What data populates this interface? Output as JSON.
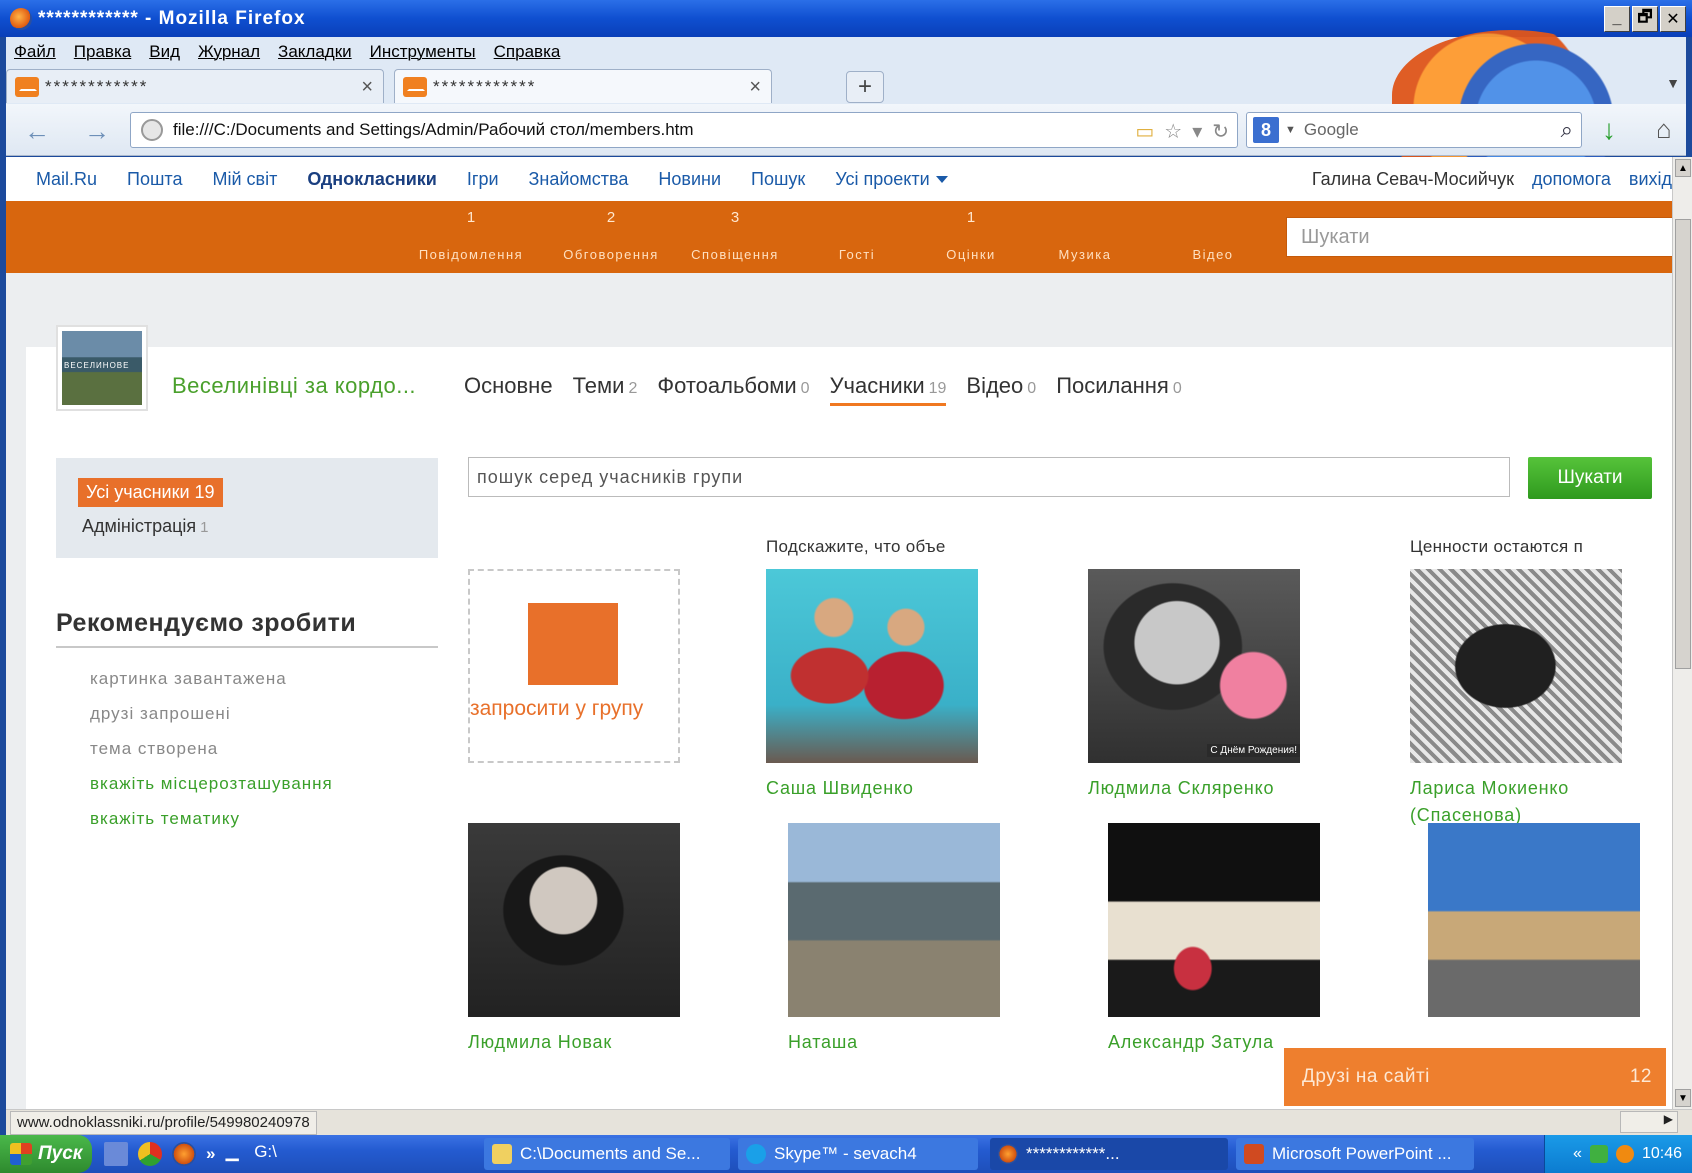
{
  "window": {
    "title": "************ - Mozilla Firefox",
    "controls": [
      "_",
      "🗗",
      "✕"
    ]
  },
  "menu": [
    "Файл",
    "Правка",
    "Вид",
    "Журнал",
    "Закладки",
    "Инструменты",
    "Справка"
  ],
  "tabs": [
    {
      "label": "************",
      "active": false,
      "close": "×"
    },
    {
      "label": "************",
      "active": true,
      "close": "×"
    }
  ],
  "newtab": "+",
  "nav": {
    "url": "file:///C:/Documents and Settings/Admin/Рабочий стол/members.htm",
    "search_placeholder": "Google",
    "search_engine": "8"
  },
  "portal": {
    "links": [
      "Mail.Ru",
      "Пошта",
      "Мій світ",
      "Однокласники",
      "Ігри",
      "Знайомства",
      "Новини",
      "Пошук",
      "Усі проекти"
    ],
    "user": "Галина Севач-Мосийчук",
    "help": "допомога",
    "logout": "вихід"
  },
  "toolbar": {
    "items": [
      {
        "label": "Повідомлення",
        "count": "1"
      },
      {
        "label": "Обговорення",
        "count": "2"
      },
      {
        "label": "Сповіщення",
        "count": "3"
      },
      {
        "label": "Гості",
        "count": ""
      },
      {
        "label": "Оцінки",
        "count": "1"
      },
      {
        "label": "Музика",
        "count": ""
      },
      {
        "label": "Відео",
        "count": ""
      }
    ],
    "search_placeholder": "Шукати"
  },
  "group": {
    "name": "Веселинівці за кордо...",
    "tabs": [
      {
        "label": "Основне",
        "count": ""
      },
      {
        "label": "Теми",
        "count": "2"
      },
      {
        "label": "Фотоальбоми",
        "count": "0"
      },
      {
        "label": "Учасники",
        "count": "19"
      },
      {
        "label": "Відео",
        "count": "0"
      },
      {
        "label": "Посилання",
        "count": "0"
      }
    ],
    "active_tab": "Учасники"
  },
  "filters": {
    "all": "Усі учасники 19",
    "admin_label": "Адміністрація",
    "admin_count": "1"
  },
  "recommend": {
    "title": "Рекомендуємо зробити",
    "items": [
      {
        "label": "картинка завантажена",
        "done": true
      },
      {
        "label": "друзі запрошені",
        "done": true
      },
      {
        "label": "тема створена",
        "done": true
      },
      {
        "label": "вкажіть місцерозташування",
        "done": false
      },
      {
        "label": "вкажіть тематику",
        "done": false
      }
    ]
  },
  "members_search": {
    "placeholder": "пошук серед учасників групи",
    "button": "Шукати"
  },
  "invite_label": "запросити у групу",
  "members": [
    {
      "name": "Саша Швиденко",
      "status": "Подскажите, что объе"
    },
    {
      "name": "Людмила Скляренко",
      "status": ""
    },
    {
      "name": "Лариса Мокиенко (Спасенова)",
      "status": "Ценности остаются п"
    },
    {
      "name": "Людмила Новак",
      "status": ""
    },
    {
      "name": "Наташа",
      "status": ""
    },
    {
      "name": "Александр Затула",
      "status": ""
    },
    {
      "name": "",
      "status": ""
    }
  ],
  "photo_caption": "С Днём Рождения!",
  "friends_online": {
    "label": "Друзі на сайті",
    "count": "12"
  },
  "statusbar": {
    "url": "www.odnoklassniki.ru/profile/549980240978"
  },
  "taskbar": {
    "start": "Пуск",
    "drive": "G:\\",
    "items": [
      {
        "label": "C:\\Documents and Se..."
      },
      {
        "label": "Skype™ - sevach4"
      },
      {
        "label": "************..."
      },
      {
        "label": "Microsoft PowerPoint ..."
      }
    ],
    "clock": "10:46"
  },
  "colors": {
    "orange": "#d8660e",
    "green": "#3aa02a",
    "link": "#1a5aa8"
  }
}
